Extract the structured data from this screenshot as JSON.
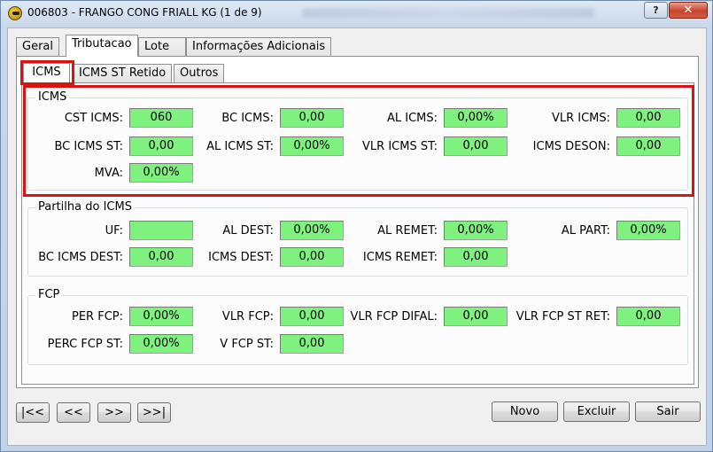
{
  "window": {
    "title": "006803 - FRANGO CONG FRIALL KG (1 de 9)",
    "help_label": "?",
    "close_label": "✕"
  },
  "tabs": [
    "Geral",
    "Tributacao",
    "Lote",
    "Informações Adicionais"
  ],
  "subtabs": [
    "ICMS",
    "ICMS ST Retido",
    "Outros"
  ],
  "icms": {
    "title": "ICMS",
    "cst_label": "CST ICMS:",
    "cst": "060",
    "bc_label": "BC ICMS:",
    "bc": "0,00",
    "al_label": "AL ICMS:",
    "al": "0,00%",
    "vlr_label": "VLR ICMS:",
    "vlr": "0,00",
    "bc_st_label": "BC ICMS ST:",
    "bc_st": "0,00",
    "al_st_label": "AL ICMS ST:",
    "al_st": "0,00%",
    "vlr_st_label": "VLR ICMS ST:",
    "vlr_st": "0,00",
    "deson_label": "ICMS DESON:",
    "deson": "0,00",
    "mva_label": "MVA:",
    "mva": "0,00%"
  },
  "partilha": {
    "title": "Partilha do ICMS",
    "uf_label": "UF:",
    "uf": "",
    "al_dest_label": "AL DEST:",
    "al_dest": "0,00%",
    "al_remet_label": "AL REMET:",
    "al_remet": "0,00%",
    "al_part_label": "AL PART:",
    "al_part": "0,00%",
    "bc_dest_label": "BC ICMS DEST:",
    "bc_dest": "0,00",
    "icms_dest_label": "ICMS DEST:",
    "icms_dest": "0,00",
    "icms_remet_label": "ICMS REMET:",
    "icms_remet": "0,00"
  },
  "fcp": {
    "title": "FCP",
    "per_label": "PER FCP:",
    "per": "0,00%",
    "vlr_label": "VLR FCP:",
    "vlr": "0,00",
    "vlr_difal_label": "VLR FCP DIFAL:",
    "vlr_difal": "0,00",
    "vlr_st_ret_label": "VLR FCP ST RET:",
    "vlr_st_ret": "0,00",
    "perc_st_label": "PERC FCP ST:",
    "perc_st": "0,00%",
    "v_st_label": "V FCP ST:",
    "v_st": "0,00"
  },
  "nav": {
    "first": "|<<",
    "prev": "<<",
    "next": ">>",
    "last": ">>|"
  },
  "actions": {
    "novo": "Novo",
    "excluir": "Excluir",
    "sair": "Sair"
  },
  "colors": {
    "field_bg": "#7ef17e",
    "highlight": "#d61414"
  }
}
